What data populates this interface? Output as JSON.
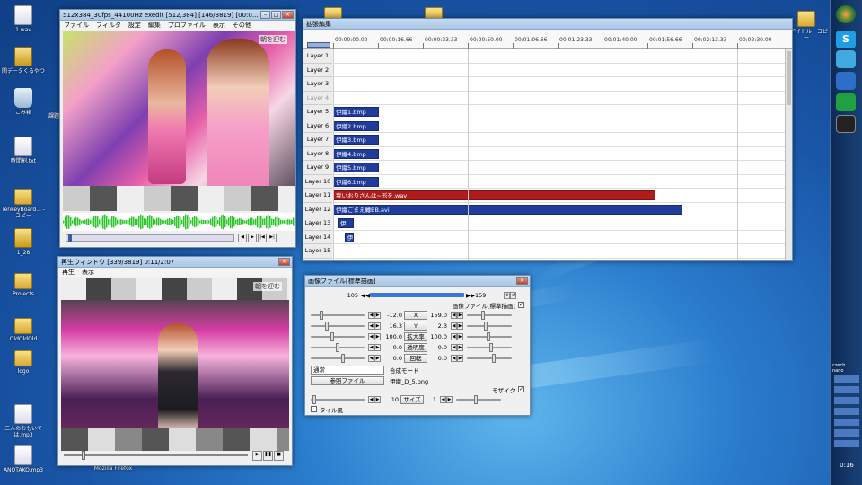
{
  "desktop": {
    "left_icons": [
      {
        "label": "1.wav",
        "type": "file"
      },
      {
        "label": "関データくるやつ",
        "type": "zip"
      },
      {
        "label": "ごみ箱",
        "type": "bin"
      },
      {
        "label": "時間割.txt",
        "type": "file"
      },
      {
        "label": "TenkeyBoard... - コピー",
        "type": "folder"
      },
      {
        "label": "1_28",
        "type": "zip"
      },
      {
        "label": "Projects",
        "type": "folder"
      },
      {
        "label": "OldOldOld",
        "type": "folder"
      },
      {
        "label": "logo",
        "type": "folder"
      },
      {
        "label": "二人のおもいでは.mp3",
        "type": "file"
      },
      {
        "label": "ANOTAKO.mp3",
        "type": "file"
      }
    ],
    "right_icon": {
      "label": "のアイドル・コピー"
    },
    "partial_labels": {
      "under_preview": "Mozilla Firefox",
      "near_track": "課題"
    }
  },
  "preview_window": {
    "title": "512x384_30fps_44100Hz exedit [512,384] [146/3819] [00:0...",
    "menu": [
      "ファイル",
      "フィルタ",
      "設定",
      "編集",
      "プロファイル",
      "表示",
      "その他"
    ],
    "overlay_text": "朝を迎む"
  },
  "playback_window": {
    "title": "再生ウィンドウ [339/3819] 0:11/2:07",
    "menu": [
      "再生",
      "表示"
    ],
    "overlay_text": "朝を迎む"
  },
  "timeline": {
    "title": "拡張編集",
    "ticks": [
      "00:00:00.00",
      "00:00:16.66",
      "00:00:33.33",
      "00:00:50.00",
      "00:01:06.66",
      "00:01:23.33",
      "00:01:40.00",
      "00:01:56.66",
      "00:02:13.33",
      "00:02:30.00"
    ],
    "layers": [
      "Layer 1",
      "Layer 2",
      "Layer 3",
      "Layer 4",
      "Layer 5",
      "Layer 6",
      "Layer 7",
      "Layer 8",
      "Layer 9",
      "Layer 10",
      "Layer 11",
      "Layer 12",
      "Layer 13",
      "Layer 14",
      "Layer 15"
    ],
    "clips": [
      {
        "layer": 5,
        "label": "伊織1.bmp",
        "start": 0.0,
        "end": 0.1,
        "color": "#1f3c9a"
      },
      {
        "layer": 6,
        "label": "伊織2.bmp",
        "start": 0.0,
        "end": 0.1,
        "color": "#1f3c9a"
      },
      {
        "layer": 7,
        "label": "伊織3.bmp",
        "start": 0.0,
        "end": 0.1,
        "color": "#1f3c9a"
      },
      {
        "layer": 8,
        "label": "伊織4.bmp",
        "start": 0.0,
        "end": 0.1,
        "color": "#1f3c9a"
      },
      {
        "layer": 9,
        "label": "伊織5.bmp",
        "start": 0.0,
        "end": 0.1,
        "color": "#1f3c9a"
      },
      {
        "layer": 10,
        "label": "伊織6.bmp",
        "start": 0.0,
        "end": 0.1,
        "color": "#1f3c9a"
      },
      {
        "layer": 11,
        "label": "我いおりさんは~形を.wav",
        "start": 0.0,
        "end": 0.71,
        "color": "#b01b1b"
      },
      {
        "layer": 12,
        "label": "伊織ごまえ轉BB.avi",
        "start": 0.0,
        "end": 0.77,
        "color": "#1f3c9a"
      },
      {
        "layer": 13,
        "label": "伊",
        "start": 0.01,
        "end": 0.045,
        "color": "#1f3c9a"
      },
      {
        "layer": 14,
        "label": "伊",
        "start": 0.025,
        "end": 0.045,
        "color": "#1f3c9a"
      }
    ]
  },
  "property_panel": {
    "title": "画像ファイル[標準描画]",
    "frame_start": "105",
    "frame_end": "159",
    "rows": [
      {
        "left": "-12.0",
        "label": "X",
        "right": "159.0"
      },
      {
        "left": "16.3",
        "label": "Y",
        "right": "2.3"
      },
      {
        "left": "100.0",
        "label": "拡大率",
        "right": "100.0"
      },
      {
        "left": "0.0",
        "label": "透明度",
        "right": "0.0"
      },
      {
        "left": "0.0",
        "label": "回転",
        "right": "0.0"
      }
    ],
    "top_check_label": "画像ファイル[標準描画]",
    "blend_mode": "通常",
    "blend_label": "合成モード",
    "ref_button": "参照ファイル",
    "file_name": "伊織_D_5.png",
    "mosaic_label": "モザイク",
    "size_left": "10",
    "size_label": "サイズ",
    "size_right": "1",
    "tile_label": "タイル風"
  },
  "sidebar": {
    "clock": "0:16",
    "gadget_labels": [
      "czech",
      "nano"
    ]
  }
}
